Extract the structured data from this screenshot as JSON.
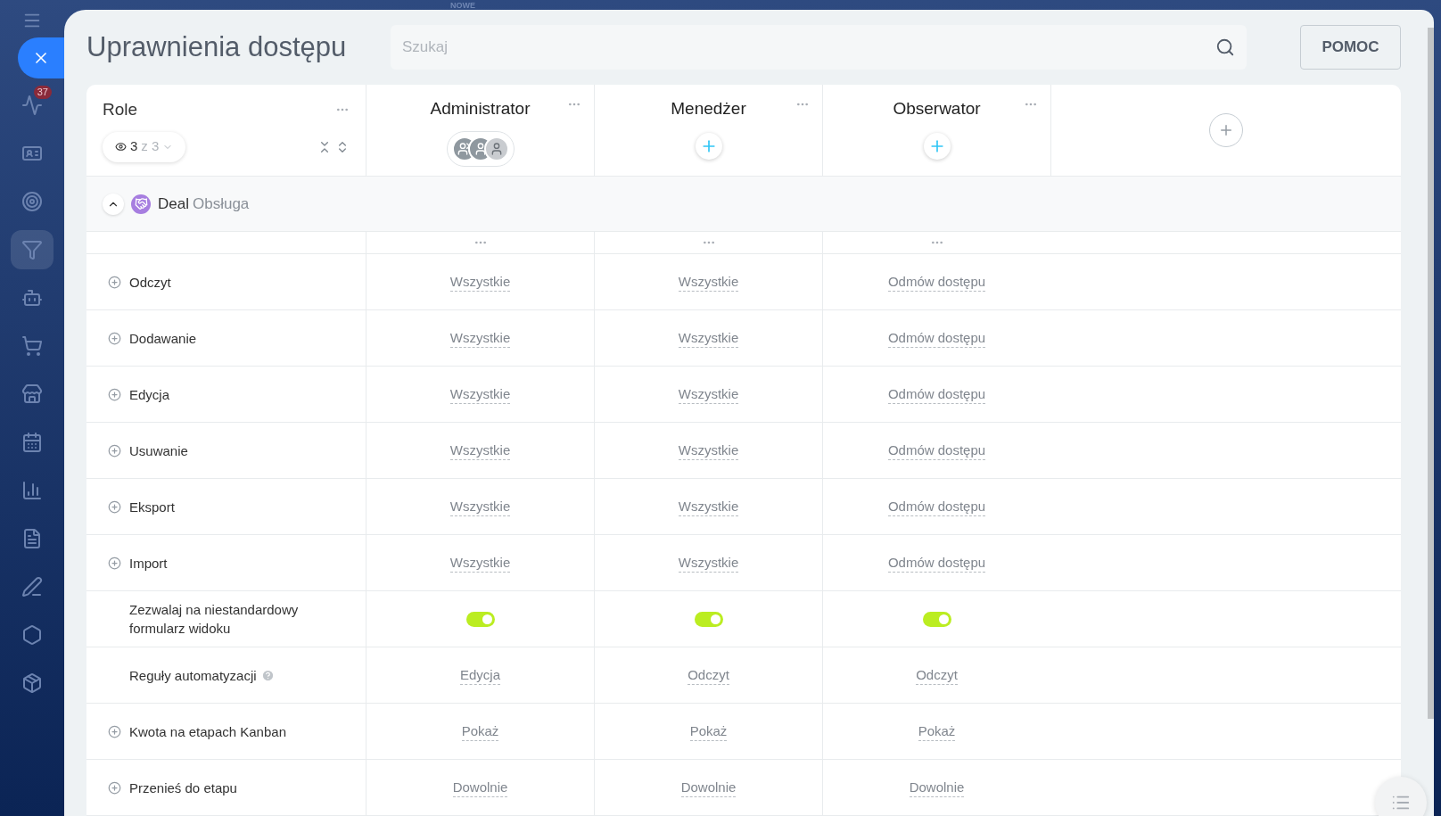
{
  "background": {
    "tab_label": "NOWE"
  },
  "sidebar": {
    "items": [
      {
        "badge": "37",
        "selected": false
      },
      {
        "selected": false
      },
      {
        "selected": false
      },
      {
        "selected": true
      },
      {
        "selected": false
      },
      {
        "selected": false
      },
      {
        "selected": false
      },
      {
        "selected": false
      },
      {
        "selected": false
      },
      {
        "selected": false
      },
      {
        "selected": false
      },
      {
        "selected": false
      },
      {
        "selected": false
      }
    ]
  },
  "page": {
    "title": "Uprawnienia dostępu",
    "search": {
      "placeholder": "Szukaj"
    },
    "help_button": "POMOC"
  },
  "table": {
    "role_header": {
      "label": "Role",
      "filter": {
        "shown": "3",
        "total": "z 3"
      }
    },
    "columns": [
      {
        "name": "Administrator",
        "members": true
      },
      {
        "name": "Menedżer",
        "members": false
      },
      {
        "name": "Obserwator",
        "members": false
      }
    ],
    "section": {
      "expanded": true,
      "entity": "Deal",
      "name": "Obsługa"
    },
    "rows": [
      {
        "label": "Odczyt",
        "expandable": true,
        "help": false,
        "kind": "select",
        "values": [
          "Wszystkie",
          "Wszystkie",
          "Odmów dostępu"
        ]
      },
      {
        "label": "Dodawanie",
        "expandable": true,
        "help": false,
        "kind": "select",
        "values": [
          "Wszystkie",
          "Wszystkie",
          "Odmów dostępu"
        ]
      },
      {
        "label": "Edycja",
        "expandable": true,
        "help": false,
        "kind": "select",
        "values": [
          "Wszystkie",
          "Wszystkie",
          "Odmów dostępu"
        ]
      },
      {
        "label": "Usuwanie",
        "expandable": true,
        "help": false,
        "kind": "select",
        "values": [
          "Wszystkie",
          "Wszystkie",
          "Odmów dostępu"
        ]
      },
      {
        "label": "Eksport",
        "expandable": true,
        "help": false,
        "kind": "select",
        "values": [
          "Wszystkie",
          "Wszystkie",
          "Odmów dostępu"
        ]
      },
      {
        "label": "Import",
        "expandable": true,
        "help": false,
        "kind": "select",
        "values": [
          "Wszystkie",
          "Wszystkie",
          "Odmów dostępu"
        ]
      },
      {
        "label": "Zezwalaj na niestandardowy formularz widoku",
        "expandable": false,
        "help": false,
        "kind": "toggle",
        "on": [
          true,
          true,
          true
        ]
      },
      {
        "label": "Reguły automatyzacji",
        "expandable": false,
        "help": true,
        "kind": "select",
        "values": [
          "Edycja",
          "Odczyt",
          "Odczyt"
        ]
      },
      {
        "label": "Kwota na etapach Kanban",
        "expandable": true,
        "help": false,
        "kind": "select",
        "values": [
          "Pokaż",
          "Pokaż",
          "Pokaż"
        ]
      },
      {
        "label": "Przenieś do etapu",
        "expandable": true,
        "help": false,
        "kind": "select",
        "values": [
          "Dowolnie",
          "Dowolnie",
          "Dowolnie"
        ]
      }
    ]
  }
}
